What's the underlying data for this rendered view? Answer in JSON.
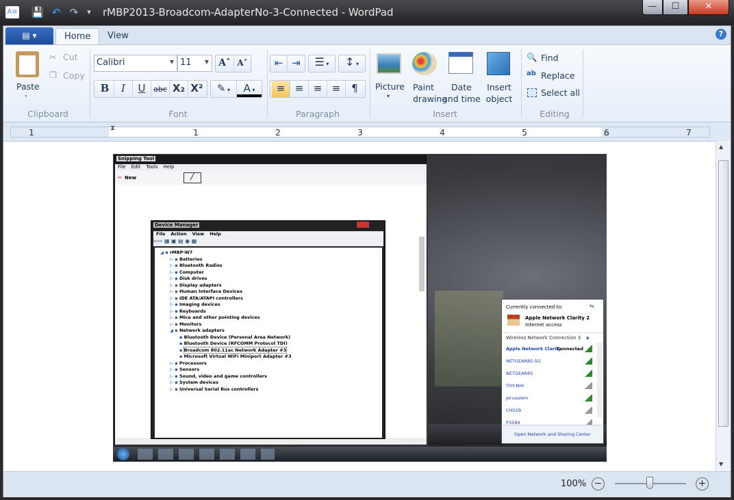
{
  "window": {
    "title": "rMBP2013-Broadcom-AdapterNo-3-Connected - WordPad",
    "minimize": "—",
    "maximize": "☐",
    "close": "✕"
  },
  "qat": {
    "app_icon": "A≡",
    "save": "💾",
    "undo": "↶",
    "redo": "↷",
    "customize": "▾"
  },
  "tabs": {
    "app_menu": "▤ ▾",
    "home": "Home",
    "view": "View",
    "help": "?"
  },
  "clipboard": {
    "paste": "Paste",
    "cut": "Cut",
    "copy": "Copy",
    "label": "Clipboard"
  },
  "font": {
    "family": "Calibri",
    "size": "11",
    "grow": "A˄",
    "shrink": "A˅",
    "bold": "B",
    "italic": "I",
    "underline": "U",
    "strike": "abc",
    "subscript": "X₂",
    "superscript": "X²",
    "highlight": "✎",
    "color": "A",
    "label": "Font"
  },
  "paragraph": {
    "label": "Paragraph",
    "decrease_indent": "⇤",
    "increase_indent": "⇥",
    "bullets": "☰",
    "line_spacing": "↕",
    "align_left": "≡",
    "align_center": "≡",
    "align_right": "≡",
    "justify": "≡",
    "paragraph": "¶"
  },
  "insert": {
    "picture": "Picture",
    "paint": "Paint drawing",
    "datetime": "Date and time",
    "object": "Insert object",
    "label": "Insert"
  },
  "editing": {
    "find": "Find",
    "replace": "Replace",
    "select_all": "Select all",
    "label": "Editing"
  },
  "ruler": {
    "numbers": [
      "1",
      "1",
      "2",
      "3",
      "4",
      "5",
      "6",
      "7"
    ]
  },
  "status": {
    "zoom": "100%",
    "zoom_out": "−",
    "zoom_in": "+"
  },
  "embedded": {
    "snipping_title": "Snipping Tool",
    "snipping_menu": [
      "File",
      "Edit",
      "Tools",
      "Help"
    ],
    "snipping_new": "New",
    "dm_title": "Device Manager",
    "dm_menu": [
      "File",
      "Action",
      "View",
      "Help"
    ],
    "dm_tree": [
      "rMBP-W7",
      "Batteries",
      "Bluetooth Radios",
      "Computer",
      "Disk drives",
      "Display adapters",
      "Human Interface Devices",
      "IDE ATA/ATAPI controllers",
      "Imaging devices",
      "Keyboards",
      "Mice and other pointing devices",
      "Monitors",
      "Network adapters",
      "Bluetooth Device (Personal Area Network)",
      "Bluetooth Device (RFCOMM Protocol TDI)",
      "Broadcom 802.11ac Network Adapter #3",
      "Microsoft Virtual WiFi Miniport Adapter #3",
      "Processors",
      "Sensors",
      "Sound, video and game controllers",
      "System devices",
      "Universal Serial Bus controllers"
    ],
    "net": {
      "connected_to": "Currently connected to:",
      "current_name": "Apple Network Clarity  2",
      "current_status": "Internet access",
      "section": "Wireless Network Connection 3",
      "networks": [
        "Apple Network Clarity",
        "NETGEAR85-5G",
        "NETGEAR85",
        "THY-NHI",
        "Jerusalem",
        "CH02B",
        "P3584"
      ],
      "connected_label": "Connected",
      "footer": "Open Network and Sharing Center"
    }
  }
}
